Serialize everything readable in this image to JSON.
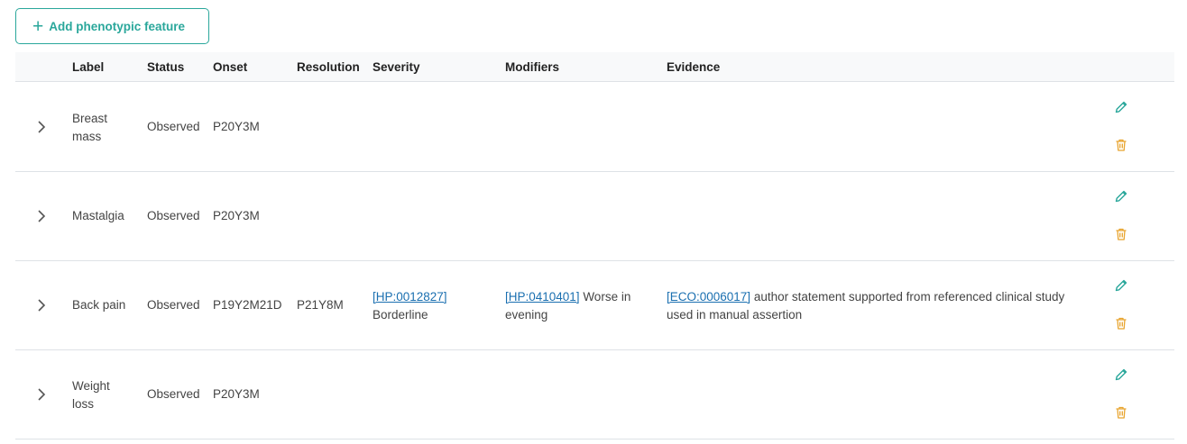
{
  "toolbar": {
    "add_label": "Add phenotypic feature"
  },
  "table": {
    "headers": {
      "label": "Label",
      "status": "Status",
      "onset": "Onset",
      "resolution": "Resolution",
      "severity": "Severity",
      "modifiers": "Modifiers",
      "evidence": "Evidence"
    },
    "rows": [
      {
        "label_line1": "Breast",
        "label_line2": "mass",
        "status": "Observed",
        "onset": "P20Y3M",
        "resolution": "",
        "severity_id": "",
        "severity_text": "",
        "modifier_id": "",
        "modifier_text1": "",
        "modifier_text2": "",
        "evidence_id": "",
        "evidence_text1": "",
        "evidence_text2": ""
      },
      {
        "label_line1": "Mastalgia",
        "label_line2": "",
        "status": "Observed",
        "onset": "P20Y3M",
        "resolution": "",
        "severity_id": "",
        "severity_text": "",
        "modifier_id": "",
        "modifier_text1": "",
        "modifier_text2": "",
        "evidence_id": "",
        "evidence_text1": "",
        "evidence_text2": ""
      },
      {
        "label_line1": "Back pain",
        "label_line2": "",
        "status": "Observed",
        "onset": "P19Y2M21D",
        "resolution": "P21Y8M",
        "severity_id": "[HP:0012827]",
        "severity_text": "Borderline",
        "modifier_id": "[HP:0410401]",
        "modifier_text1": " Worse in",
        "modifier_text2": "evening",
        "evidence_id": "[ECO:0006017]",
        "evidence_text1": " author statement supported from referenced clinical study",
        "evidence_text2": "used in manual assertion"
      },
      {
        "label_line1": "Weight",
        "label_line2": "loss",
        "status": "Observed",
        "onset": "P20Y3M",
        "resolution": "",
        "severity_id": "",
        "severity_text": "",
        "modifier_id": "",
        "modifier_text1": "",
        "modifier_text2": "",
        "evidence_id": "",
        "evidence_text1": "",
        "evidence_text2": ""
      }
    ]
  },
  "icons": {
    "expand": "chevron-right-icon",
    "edit": "pencil-icon",
    "delete": "trash-icon"
  },
  "colors": {
    "accent": "#2aa79b",
    "delete": "#e8a42e",
    "link": "#1a6fb0"
  }
}
